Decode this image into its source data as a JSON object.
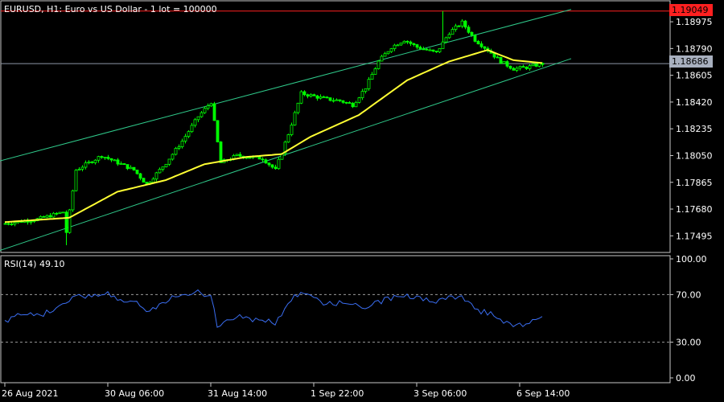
{
  "main_title": "EURUSD, H1:  Euro vs US Dollar - 1 lot = 100000",
  "rsi_title": "RSI(14) 49.10",
  "colors": {
    "background": "#000000",
    "frame": "#c8c8c8",
    "candle": "#00ff00",
    "ma": "#ffff33",
    "channel": "#2fc98a",
    "bid_line": "#8d96a6",
    "high_line": "#ff2020",
    "high_badge": "#ff2020",
    "bid_badge": "#a8b0bf",
    "rsi": "#3a6df0",
    "rsi_levels": "#9a9a9a"
  },
  "price_axis": {
    "min": 1.1738,
    "max": 1.1912,
    "ticks": [
      "1.18975",
      "1.18790",
      "1.18605",
      "1.18420",
      "1.18235",
      "1.18050",
      "1.17865",
      "1.17680",
      "1.17495"
    ]
  },
  "price_badges": {
    "high_label": "1.19049",
    "bid_label": "1.18686"
  },
  "rsi_axis": {
    "min": 0,
    "max": 100,
    "ticks": [
      "100.00",
      "70.00",
      "30.00",
      "0.00"
    ],
    "levels": [
      70,
      30
    ]
  },
  "time_axis": {
    "labels": [
      "26 Aug 2021",
      "30 Aug 06:00",
      "31 Aug 14:00",
      "1 Sep 22:00",
      "3 Sep 06:00",
      "6 Sep 14:00"
    ],
    "label_bars": [
      0,
      32,
      64,
      96,
      128,
      160
    ]
  },
  "chart_data": {
    "type": "candlestick",
    "symbol": "EURUSD",
    "timeframe": "H1",
    "bars": 168,
    "key_closes": [
      [
        0,
        1.1758
      ],
      [
        10,
        1.1761
      ],
      [
        18,
        1.1766
      ],
      [
        19,
        1.1752
      ],
      [
        22,
        1.1795
      ],
      [
        30,
        1.1805
      ],
      [
        40,
        1.1795
      ],
      [
        44,
        1.1785
      ],
      [
        50,
        1.18
      ],
      [
        55,
        1.1815
      ],
      [
        60,
        1.1832
      ],
      [
        64,
        1.1842
      ],
      [
        67,
        1.18
      ],
      [
        72,
        1.1805
      ],
      [
        80,
        1.1803
      ],
      [
        84,
        1.1795
      ],
      [
        88,
        1.182
      ],
      [
        92,
        1.1848
      ],
      [
        100,
        1.1844
      ],
      [
        104,
        1.1843
      ],
      [
        108,
        1.184
      ],
      [
        112,
        1.1852
      ],
      [
        116,
        1.187
      ],
      [
        120,
        1.188
      ],
      [
        124,
        1.1885
      ],
      [
        128,
        1.188
      ],
      [
        134,
        1.1876
      ],
      [
        138,
        1.189
      ],
      [
        142,
        1.1897
      ],
      [
        146,
        1.1885
      ],
      [
        150,
        1.1878
      ],
      [
        154,
        1.187
      ],
      [
        158,
        1.1865
      ],
      [
        162,
        1.1866
      ],
      [
        167,
        1.18686
      ]
    ],
    "bar_spikes": [
      {
        "bar": 19,
        "low": 1.1743
      },
      {
        "bar": 136,
        "high": 1.19049
      }
    ],
    "moving_average": {
      "period": 20,
      "key_values": [
        [
          0,
          1.1759
        ],
        [
          20,
          1.1762
        ],
        [
          35,
          1.178
        ],
        [
          50,
          1.1788
        ],
        [
          62,
          1.1799
        ],
        [
          75,
          1.1804
        ],
        [
          86,
          1.1806
        ],
        [
          95,
          1.1818
        ],
        [
          110,
          1.1833
        ],
        [
          125,
          1.1857
        ],
        [
          138,
          1.187
        ],
        [
          150,
          1.1878
        ],
        [
          158,
          1.1871
        ],
        [
          167,
          1.1869
        ]
      ]
    },
    "channel": {
      "upper": {
        "start": [
          -2,
          1.1801
        ],
        "end": [
          176,
          1.1906
        ]
      },
      "lower": {
        "start": [
          -2,
          1.1739
        ],
        "end": [
          176,
          1.1872
        ]
      }
    },
    "high_level": 1.19049,
    "bid": 1.18686,
    "rsi": {
      "period": 14,
      "last": 49.1,
      "key_values": [
        [
          0,
          48
        ],
        [
          6,
          55
        ],
        [
          12,
          54
        ],
        [
          18,
          60
        ],
        [
          22,
          70
        ],
        [
          28,
          68
        ],
        [
          32,
          71
        ],
        [
          36,
          64
        ],
        [
          40,
          66
        ],
        [
          44,
          57
        ],
        [
          48,
          61
        ],
        [
          52,
          67
        ],
        [
          56,
          71
        ],
        [
          60,
          72
        ],
        [
          64,
          69
        ],
        [
          66,
          45
        ],
        [
          72,
          52
        ],
        [
          80,
          48
        ],
        [
          84,
          46
        ],
        [
          88,
          62
        ],
        [
          92,
          73
        ],
        [
          96,
          66
        ],
        [
          100,
          62
        ],
        [
          108,
          64
        ],
        [
          112,
          58
        ],
        [
          118,
          66
        ],
        [
          124,
          70
        ],
        [
          130,
          66
        ],
        [
          134,
          63
        ],
        [
          138,
          67
        ],
        [
          142,
          70
        ],
        [
          146,
          57
        ],
        [
          150,
          55
        ],
        [
          154,
          48
        ],
        [
          158,
          44
        ],
        [
          162,
          46
        ],
        [
          167,
          49.1
        ]
      ]
    }
  }
}
